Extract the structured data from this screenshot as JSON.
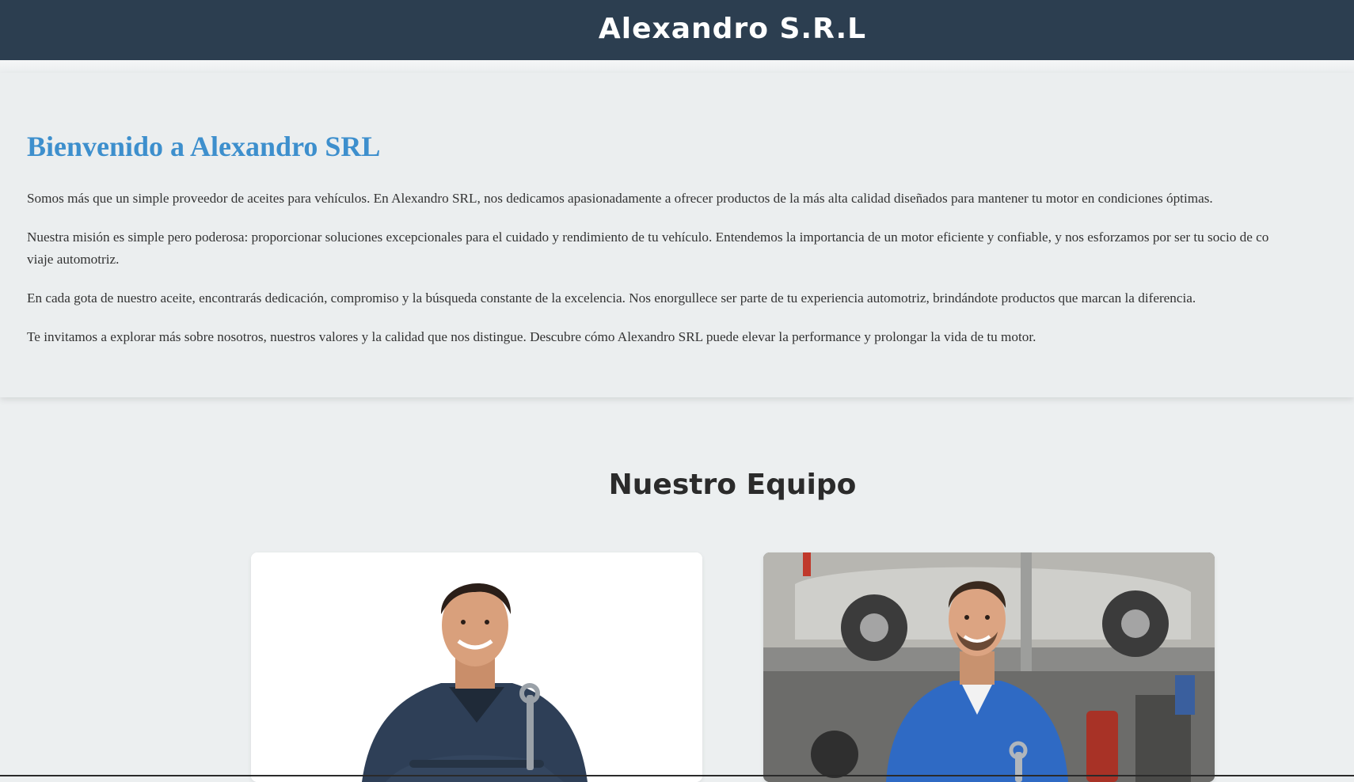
{
  "header": {
    "brand": "Alexandro S.R.L"
  },
  "about": {
    "title": "Bienvenido a Alexandro SRL",
    "paragraph1": "Somos más que un simple proveedor de aceites para vehículos. En Alexandro SRL, nos dedicamos apasionadamente a ofrecer productos de la más alta calidad diseñados para mantener tu motor en condiciones óptimas.",
    "paragraph2_line1": "Nuestra misión es simple pero poderosa: proporcionar soluciones excepcionales para el cuidado y rendimiento de tu vehículo. Entendemos la importancia de un motor eficiente y confiable, y nos esforzamos por ser tu socio de co",
    "paragraph2_line2": "viaje automotriz.",
    "paragraph3": "En cada gota de nuestro aceite, encontrarás dedicación, compromiso y la búsqueda constante de la excelencia. Nos enorgullece ser parte de tu experiencia automotriz, brindándote productos que marcan la diferencia.",
    "paragraph4": "Te invitamos a explorar más sobre nosotros, nuestros valores y la calidad que nos distingue. Descubre cómo Alexandro SRL puede elevar la performance y prolongar la vida de tu motor."
  },
  "team": {
    "title": "Nuestro Equipo",
    "members": [
      {
        "photo": "mechanic-crossed-arms-photo"
      },
      {
        "photo": "mechanic-in-garage-photo"
      }
    ]
  },
  "colors": {
    "header_bg": "#2c3e50",
    "accent": "#3d8fcd",
    "page_bg": "#eceff0"
  }
}
